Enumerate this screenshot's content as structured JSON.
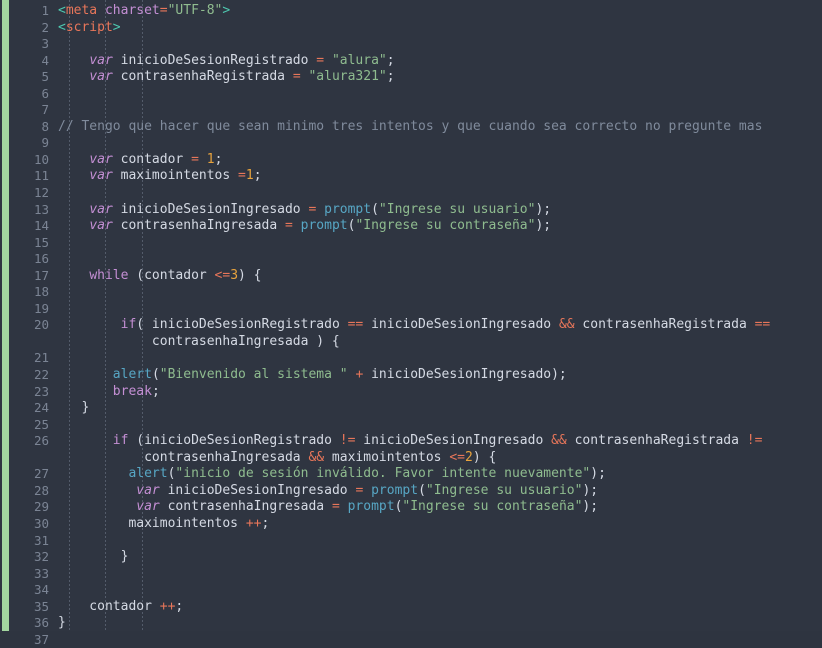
{
  "editor": {
    "language": "javascript-html",
    "theme_name": "dark-nord-like",
    "colors": {
      "background": "#2f3541",
      "gutter_text": "#7b8494",
      "change_marker": "#a3d6a0",
      "default_text": "#d5dae4",
      "comment": "#808b9c",
      "keyword": "#c48fd4",
      "string": "#8fbc8f",
      "number": "#e8a33d",
      "function": "#57a6c4",
      "operator": "#e8765a",
      "tag": "#e8765a",
      "bracket": "#4ec9b0",
      "indent_guide": "#545c6b"
    },
    "first_line": 1,
    "last_line": 37,
    "line_numbers": [
      "1",
      "2",
      "3",
      "4",
      "5",
      "6",
      "7",
      "8",
      "9",
      "10",
      "11",
      "12",
      "13",
      "14",
      "15",
      "16",
      "17",
      "18",
      "19",
      "20",
      "",
      "21",
      "22",
      "23",
      "24",
      "25",
      "26",
      "",
      "27",
      "28",
      "29",
      "30",
      "31",
      "32",
      "33",
      "34",
      "35",
      "36",
      "37"
    ],
    "lines": [
      {
        "number": "1",
        "tokens": [
          {
            "text": "<",
            "type": "bracket"
          },
          {
            "text": "meta",
            "type": "tag"
          },
          {
            "text": " ",
            "type": "plain"
          },
          {
            "text": "charset",
            "type": "attr"
          },
          {
            "text": "=",
            "type": "op"
          },
          {
            "text": "\"UTF-8\"",
            "type": "string"
          },
          {
            "text": ">",
            "type": "bracket"
          }
        ]
      },
      {
        "number": "2",
        "tokens": [
          {
            "text": "<",
            "type": "bracket"
          },
          {
            "text": "script",
            "type": "tag"
          },
          {
            "text": ">",
            "type": "bracket"
          }
        ]
      },
      {
        "number": "3",
        "tokens": []
      },
      {
        "number": "4",
        "tokens": [
          {
            "text": "    ",
            "type": "plain"
          },
          {
            "text": "var",
            "type": "var"
          },
          {
            "text": " inicioDeSesionRegistrado ",
            "type": "plain"
          },
          {
            "text": "=",
            "type": "op"
          },
          {
            "text": " ",
            "type": "plain"
          },
          {
            "text": "\"alura\"",
            "type": "string"
          },
          {
            "text": ";",
            "type": "punct"
          }
        ]
      },
      {
        "number": "5",
        "tokens": [
          {
            "text": "    ",
            "type": "plain"
          },
          {
            "text": "var",
            "type": "var"
          },
          {
            "text": " contrasenhaRegistrada ",
            "type": "plain"
          },
          {
            "text": "=",
            "type": "op"
          },
          {
            "text": " ",
            "type": "plain"
          },
          {
            "text": "\"alura321\"",
            "type": "string"
          },
          {
            "text": ";",
            "type": "punct"
          }
        ]
      },
      {
        "number": "6",
        "tokens": []
      },
      {
        "number": "7",
        "tokens": []
      },
      {
        "number": "8",
        "tokens": [
          {
            "text": "// Tengo que hacer que sean minimo tres intentos y que cuando sea correcto no pregunte mas",
            "type": "comment"
          }
        ]
      },
      {
        "number": "9",
        "tokens": []
      },
      {
        "number": "10",
        "tokens": [
          {
            "text": "    ",
            "type": "plain"
          },
          {
            "text": "var",
            "type": "var"
          },
          {
            "text": " contador ",
            "type": "plain"
          },
          {
            "text": "=",
            "type": "op"
          },
          {
            "text": " ",
            "type": "plain"
          },
          {
            "text": "1",
            "type": "number"
          },
          {
            "text": ";",
            "type": "punct"
          }
        ]
      },
      {
        "number": "11",
        "tokens": [
          {
            "text": "    ",
            "type": "plain"
          },
          {
            "text": "var",
            "type": "var"
          },
          {
            "text": " maximointentos ",
            "type": "plain"
          },
          {
            "text": "=",
            "type": "op"
          },
          {
            "text": "1",
            "type": "number"
          },
          {
            "text": ";",
            "type": "punct"
          }
        ]
      },
      {
        "number": "12",
        "tokens": []
      },
      {
        "number": "13",
        "tokens": [
          {
            "text": "    ",
            "type": "plain"
          },
          {
            "text": "var",
            "type": "var"
          },
          {
            "text": " inicioDeSesionIngresado ",
            "type": "plain"
          },
          {
            "text": "=",
            "type": "op"
          },
          {
            "text": " ",
            "type": "plain"
          },
          {
            "text": "prompt",
            "type": "func"
          },
          {
            "text": "(",
            "type": "punct"
          },
          {
            "text": "\"Ingrese su usuario\"",
            "type": "string"
          },
          {
            "text": ");",
            "type": "punct"
          }
        ]
      },
      {
        "number": "14",
        "tokens": [
          {
            "text": "    ",
            "type": "plain"
          },
          {
            "text": "var",
            "type": "var"
          },
          {
            "text": " contrasenhaIngresada ",
            "type": "plain"
          },
          {
            "text": "=",
            "type": "op"
          },
          {
            "text": " ",
            "type": "plain"
          },
          {
            "text": "prompt",
            "type": "func"
          },
          {
            "text": "(",
            "type": "punct"
          },
          {
            "text": "\"Ingrese su contraseña\"",
            "type": "string"
          },
          {
            "text": ");",
            "type": "punct"
          }
        ]
      },
      {
        "number": "15",
        "tokens": []
      },
      {
        "number": "16",
        "tokens": []
      },
      {
        "number": "17",
        "tokens": [
          {
            "text": "    ",
            "type": "plain"
          },
          {
            "text": "while",
            "type": "kw-ctrl"
          },
          {
            "text": " (contador ",
            "type": "plain"
          },
          {
            "text": "<=",
            "type": "op"
          },
          {
            "text": "3",
            "type": "number"
          },
          {
            "text": ") {",
            "type": "punct"
          }
        ]
      },
      {
        "number": "18",
        "tokens": []
      },
      {
        "number": "19",
        "tokens": []
      },
      {
        "number": "20",
        "tokens": [
          {
            "text": "        ",
            "type": "plain"
          },
          {
            "text": "if",
            "type": "kw-ctrl"
          },
          {
            "text": "( inicioDeSesionRegistrado ",
            "type": "plain"
          },
          {
            "text": "==",
            "type": "op"
          },
          {
            "text": " inicioDeSesionIngresado ",
            "type": "plain"
          },
          {
            "text": "&&",
            "type": "op"
          },
          {
            "text": " contrasenhaRegistrada ",
            "type": "plain"
          },
          {
            "text": "==",
            "type": "op"
          }
        ]
      },
      {
        "number": "",
        "tokens": [
          {
            "text": "            contrasenhaIngresada ) {",
            "type": "plain"
          }
        ]
      },
      {
        "number": "21",
        "tokens": []
      },
      {
        "number": "22",
        "tokens": [
          {
            "text": "       ",
            "type": "plain"
          },
          {
            "text": "alert",
            "type": "func"
          },
          {
            "text": "(",
            "type": "punct"
          },
          {
            "text": "\"Bienvenido al sistema \"",
            "type": "string"
          },
          {
            "text": " ",
            "type": "plain"
          },
          {
            "text": "+",
            "type": "op"
          },
          {
            "text": " inicioDeSesionIngresado);",
            "type": "plain"
          }
        ]
      },
      {
        "number": "23",
        "tokens": [
          {
            "text": "       ",
            "type": "plain"
          },
          {
            "text": "break",
            "type": "keyword"
          },
          {
            "text": ";",
            "type": "punct"
          }
        ]
      },
      {
        "number": "24",
        "tokens": [
          {
            "text": "   }",
            "type": "punct"
          }
        ]
      },
      {
        "number": "25",
        "tokens": []
      },
      {
        "number": "26",
        "tokens": [
          {
            "text": "       ",
            "type": "plain"
          },
          {
            "text": "if",
            "type": "kw-ctrl"
          },
          {
            "text": " (inicioDeSesionRegistrado ",
            "type": "plain"
          },
          {
            "text": "!=",
            "type": "op"
          },
          {
            "text": " inicioDeSesionIngresado ",
            "type": "plain"
          },
          {
            "text": "&&",
            "type": "op"
          },
          {
            "text": " contrasenhaRegistrada ",
            "type": "plain"
          },
          {
            "text": "!=",
            "type": "op"
          }
        ]
      },
      {
        "number": "",
        "tokens": [
          {
            "text": "           contrasenhaIngresada ",
            "type": "plain"
          },
          {
            "text": "&&",
            "type": "op"
          },
          {
            "text": " maximointentos ",
            "type": "plain"
          },
          {
            "text": "<=",
            "type": "op"
          },
          {
            "text": "2",
            "type": "number"
          },
          {
            "text": ") {",
            "type": "punct"
          }
        ]
      },
      {
        "number": "27",
        "tokens": [
          {
            "text": "         ",
            "type": "plain"
          },
          {
            "text": "alert",
            "type": "func"
          },
          {
            "text": "(",
            "type": "punct"
          },
          {
            "text": "\"inicio de sesión inválido. Favor intente nuevamente\"",
            "type": "string"
          },
          {
            "text": ");",
            "type": "punct"
          }
        ]
      },
      {
        "number": "28",
        "tokens": [
          {
            "text": "          ",
            "type": "plain"
          },
          {
            "text": "var",
            "type": "var"
          },
          {
            "text": " inicioDeSesionIngresado ",
            "type": "plain"
          },
          {
            "text": "=",
            "type": "op"
          },
          {
            "text": " ",
            "type": "plain"
          },
          {
            "text": "prompt",
            "type": "func"
          },
          {
            "text": "(",
            "type": "punct"
          },
          {
            "text": "\"Ingrese su usuario\"",
            "type": "string"
          },
          {
            "text": ");",
            "type": "punct"
          }
        ]
      },
      {
        "number": "29",
        "tokens": [
          {
            "text": "          ",
            "type": "plain"
          },
          {
            "text": "var",
            "type": "var"
          },
          {
            "text": " contrasenhaIngresada ",
            "type": "plain"
          },
          {
            "text": "=",
            "type": "op"
          },
          {
            "text": " ",
            "type": "plain"
          },
          {
            "text": "prompt",
            "type": "func"
          },
          {
            "text": "(",
            "type": "punct"
          },
          {
            "text": "\"Ingrese su contraseña\"",
            "type": "string"
          },
          {
            "text": ");",
            "type": "punct"
          }
        ]
      },
      {
        "number": "30",
        "tokens": [
          {
            "text": "         maximointentos ",
            "type": "plain"
          },
          {
            "text": "++",
            "type": "op"
          },
          {
            "text": ";",
            "type": "punct"
          }
        ]
      },
      {
        "number": "31",
        "tokens": []
      },
      {
        "number": "32",
        "tokens": [
          {
            "text": "        }",
            "type": "punct"
          }
        ]
      },
      {
        "number": "33",
        "tokens": []
      },
      {
        "number": "34",
        "tokens": []
      },
      {
        "number": "35",
        "tokens": [
          {
            "text": "    contador ",
            "type": "plain"
          },
          {
            "text": "++",
            "type": "op"
          },
          {
            "text": ";",
            "type": "punct"
          }
        ]
      },
      {
        "number": "36",
        "tokens": [
          {
            "text": "}",
            "type": "punct"
          }
        ]
      },
      {
        "number": "37",
        "tokens": []
      }
    ],
    "indent_guide_positions": [
      11,
      47,
      84
    ]
  }
}
